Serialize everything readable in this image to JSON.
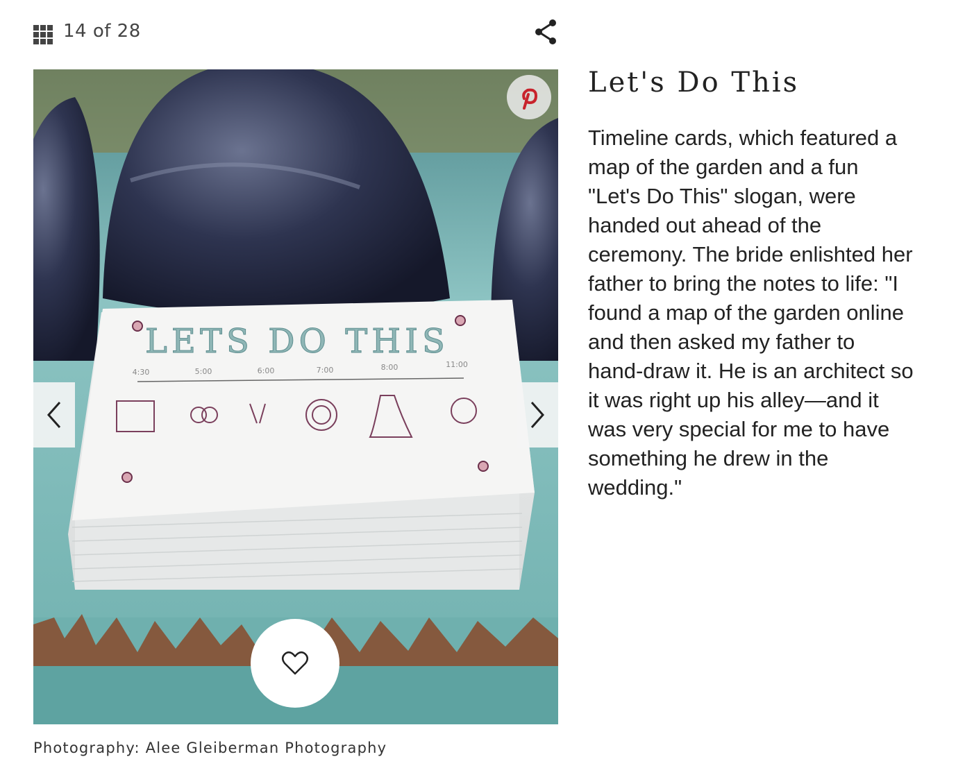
{
  "gallery": {
    "current": "14",
    "total": "28",
    "counter_text": "14 of 28"
  },
  "icons": {
    "grid": "grid-icon",
    "share": "share-icon",
    "pinterest": "pinterest-icon",
    "prev": "chevron-left-icon",
    "next": "chevron-right-icon",
    "favorite": "heart-icon"
  },
  "photo": {
    "card_title": "LETS DO THIS",
    "card_times": [
      "4:30",
      "5:00",
      "6:00",
      "7:00",
      "8:00",
      "11:00"
    ],
    "credit": "Photography: Alee Gleiberman Photography"
  },
  "article": {
    "title": "Let's Do This",
    "description": "Timeline cards, which featured a map of the garden and a fun \"Let's Do This\" slogan, were handed out ahead of the ceremony. The bride enlishted her father to bring the notes to life: \"I found a map of the garden online and then asked my father to hand-draw it. He is an architect so it was right up his alley—and it was very special for me to have something he drew in the wedding.\""
  },
  "colors": {
    "pinterest_red": "#c8232c",
    "text": "#222222"
  }
}
